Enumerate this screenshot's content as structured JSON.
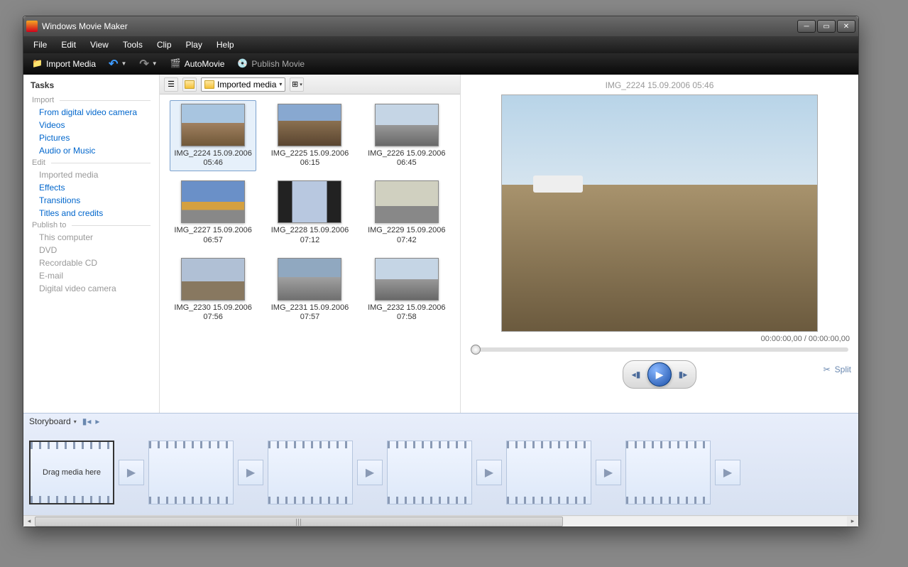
{
  "app": {
    "title": "Windows Movie Maker"
  },
  "menu": [
    "File",
    "Edit",
    "View",
    "Tools",
    "Clip",
    "Play",
    "Help"
  ],
  "toolbar": {
    "import_media": "Import Media",
    "automovie": "AutoMovie",
    "publish_movie": "Publish Movie"
  },
  "tasks": {
    "header": "Tasks",
    "sections": [
      {
        "title": "Import",
        "items": [
          {
            "label": "From digital video camera",
            "enabled": true
          },
          {
            "label": "Videos",
            "enabled": true
          },
          {
            "label": "Pictures",
            "enabled": true
          },
          {
            "label": "Audio or Music",
            "enabled": true
          }
        ]
      },
      {
        "title": "Edit",
        "items": [
          {
            "label": "Imported media",
            "enabled": false
          },
          {
            "label": "Effects",
            "enabled": true
          },
          {
            "label": "Transitions",
            "enabled": true
          },
          {
            "label": "Titles and credits",
            "enabled": true
          }
        ]
      },
      {
        "title": "Publish to",
        "items": [
          {
            "label": "This computer",
            "enabled": false
          },
          {
            "label": "DVD",
            "enabled": false
          },
          {
            "label": "Recordable CD",
            "enabled": false
          },
          {
            "label": "E-mail",
            "enabled": false
          },
          {
            "label": "Digital video camera",
            "enabled": false
          }
        ]
      }
    ]
  },
  "collection": {
    "dropdown_label": "Imported media",
    "items": [
      {
        "name": "IMG_2224 15.09.2006 05:46",
        "cls": "sky-ground",
        "selected": true
      },
      {
        "name": "IMG_2225 15.09.2006 06:15",
        "cls": "sky-arches"
      },
      {
        "name": "IMG_2226 15.09.2006 06:45",
        "cls": "sky-road"
      },
      {
        "name": "IMG_2227 15.09.2006 06:57",
        "cls": "mosque"
      },
      {
        "name": "IMG_2228 15.09.2006 07:12",
        "cls": "city-dark"
      },
      {
        "name": "IMG_2229 15.09.2006 07:42",
        "cls": "dust"
      },
      {
        "name": "IMG_2230 15.09.2006 07:56",
        "cls": "smoke"
      },
      {
        "name": "IMG_2231 15.09.2006 07:57",
        "cls": "road2"
      },
      {
        "name": "IMG_2232 15.09.2006 07:58",
        "cls": "sky-road"
      }
    ]
  },
  "preview": {
    "title": "IMG_2224 15.09.2006 05:46",
    "time": "00:00:00,00 / 00:00:00,00",
    "split_label": "Split"
  },
  "storyboard": {
    "title": "Storyboard",
    "drag_hint": "Drag media here",
    "slots": 6
  }
}
